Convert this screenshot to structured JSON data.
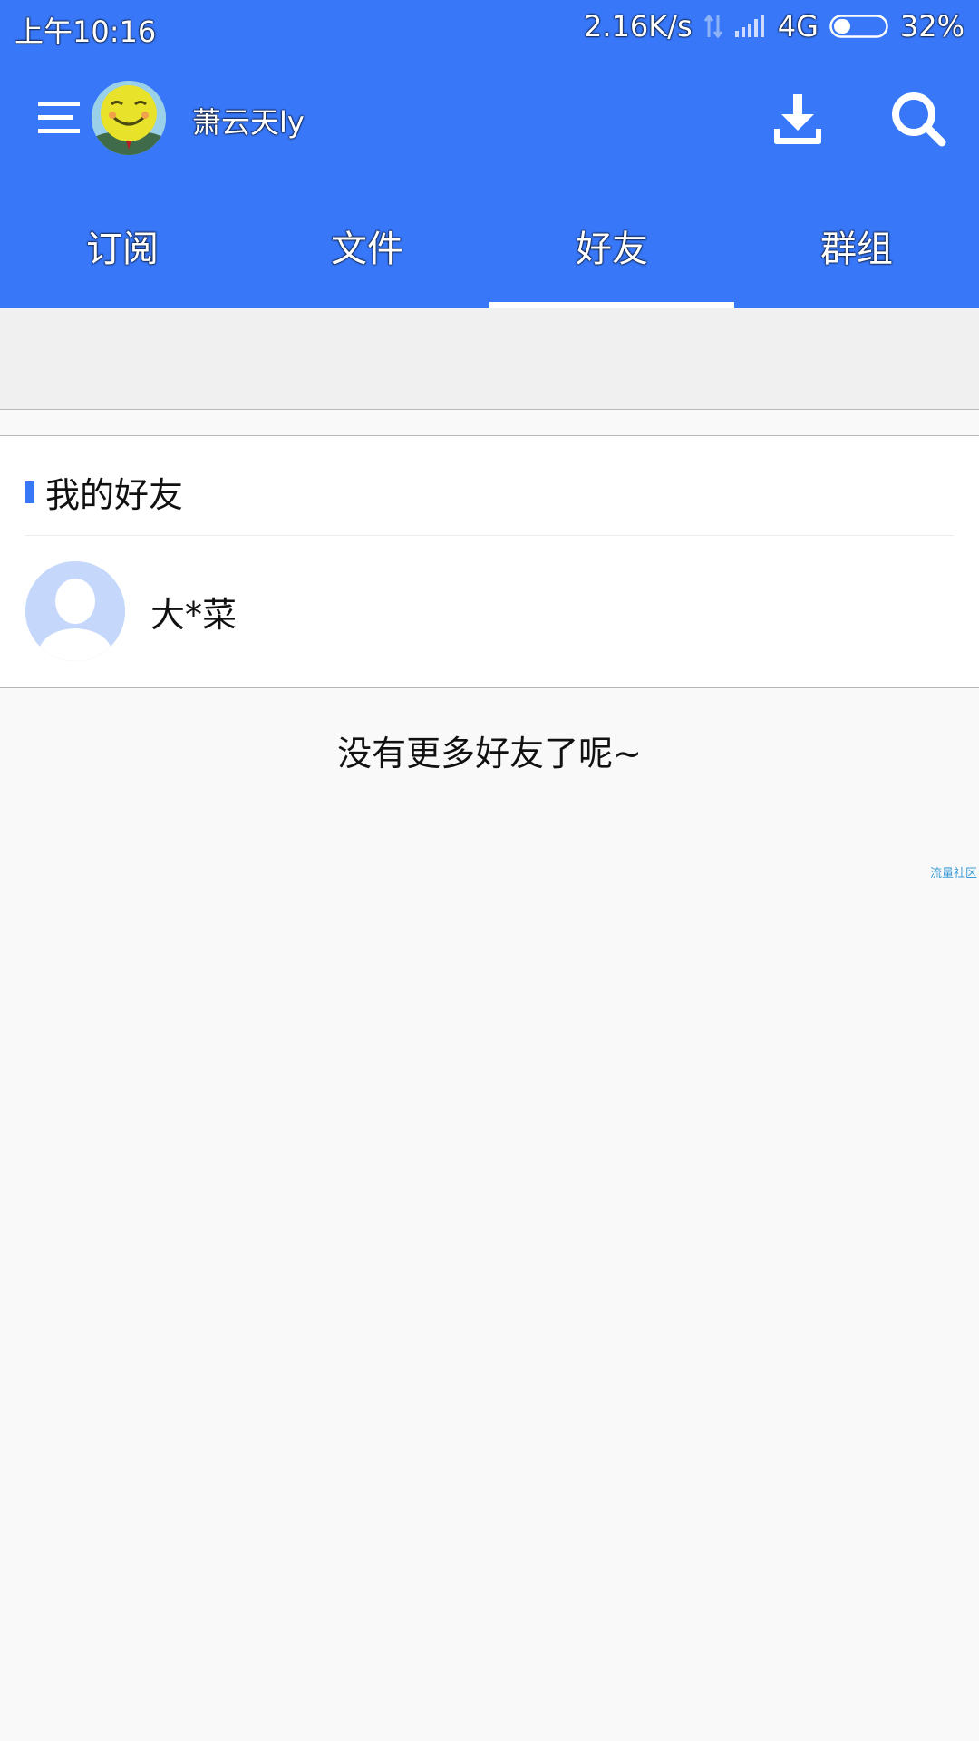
{
  "status_bar": {
    "time": "上午10:16",
    "net_speed": "2.16K/s",
    "network": "4G",
    "battery": "32%",
    "battery_level": 0.32
  },
  "appbar": {
    "username": "萧云天ly",
    "menu_icon": "menu-icon",
    "download_icon": "download-icon",
    "search_icon": "search-icon"
  },
  "tabs": [
    {
      "label": "订阅",
      "active": false
    },
    {
      "label": "文件",
      "active": false
    },
    {
      "label": "好友",
      "active": true
    },
    {
      "label": "群组",
      "active": false
    }
  ],
  "friends_section": {
    "title": "我的好友",
    "friends": [
      {
        "name": "大*菜",
        "avatar": "default-avatar-icon"
      }
    ]
  },
  "footer": {
    "no_more_text": "没有更多好友了呢~",
    "watermark": "流量社区"
  },
  "colors": {
    "brand": "#3877f8",
    "background": "#f9f9f9",
    "avatar_placeholder": "#c5d8fb"
  }
}
